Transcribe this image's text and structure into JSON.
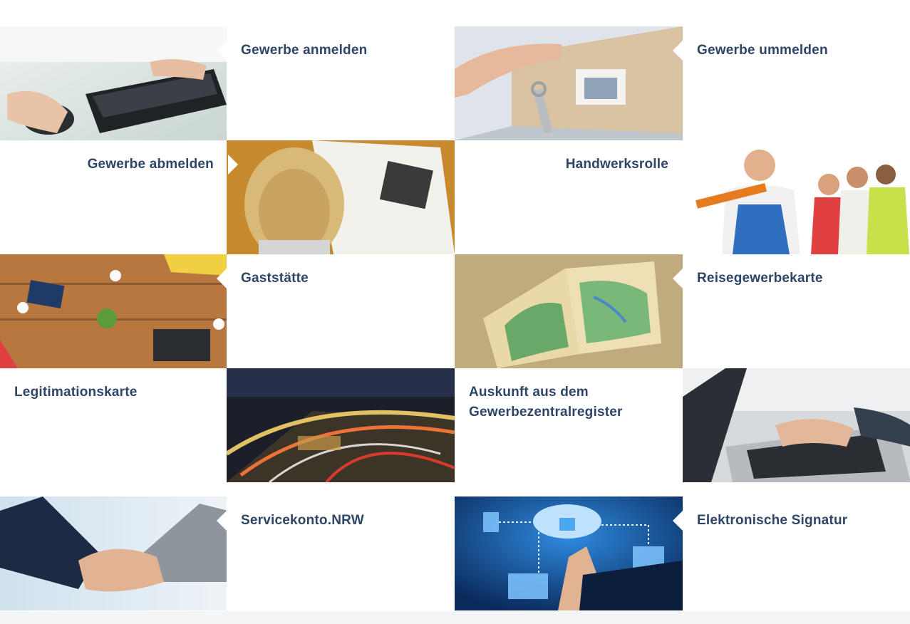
{
  "tiles": [
    {
      "label": "Gewerbe anmelden",
      "image": "hands-keyboard-mouse-photo"
    },
    {
      "label": "Gewerbe ummelden",
      "image": "house-keys-photo"
    },
    {
      "label": "Gewerbe abmelden",
      "image": "woman-calculator-paperwork-photo"
    },
    {
      "label": "Handwerksrolle",
      "image": "craftsmen-group-photo"
    },
    {
      "label": "Gaststätte",
      "image": "cafe-table-meeting-photo"
    },
    {
      "label": "Reisegewerbekarte",
      "image": "atlas-map-photo"
    },
    {
      "label": "Legitimationskarte",
      "image": "night-traffic-light-trails-photo"
    },
    {
      "label": "Auskunft aus dem Gewerbezentralregister",
      "image": "laptop-typing-photo"
    },
    {
      "label": "Servicekonto.NRW",
      "image": "handshake-photo"
    },
    {
      "label": "Elektronische Signatur",
      "image": "cloud-security-lock-photo"
    }
  ],
  "colors": {
    "label": "#2e4566",
    "background": "#ffffff"
  }
}
